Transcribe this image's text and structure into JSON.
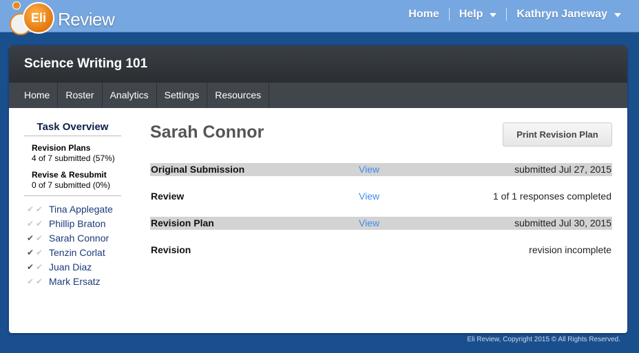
{
  "brand": {
    "logo_bubble": "Eli",
    "logo_word": "Review",
    "accent": "#e88a1d"
  },
  "topnav": {
    "home": "Home",
    "help": "Help",
    "user": "Kathryn Janeway"
  },
  "course": {
    "title": "Science Writing 101"
  },
  "tabs": [
    "Home",
    "Roster",
    "Analytics",
    "Settings",
    "Resources"
  ],
  "sidebar": {
    "title": "Task Overview",
    "stats": [
      {
        "label": "Revision Plans",
        "value": "4 of 7 submitted (57%)"
      },
      {
        "label": "Revise & Resubmit",
        "value": "0 of 7 submitted (0%)"
      }
    ],
    "students": [
      {
        "name": "Tina Applegate",
        "checks": [
          false,
          false
        ]
      },
      {
        "name": "Phillip Braton",
        "checks": [
          false,
          false
        ]
      },
      {
        "name": "Sarah Connor",
        "checks": [
          true,
          false
        ]
      },
      {
        "name": "Tenzin Corlat",
        "checks": [
          true,
          false
        ]
      },
      {
        "name": "Juan Diaz",
        "checks": [
          true,
          false
        ]
      },
      {
        "name": "Mark Ersatz",
        "checks": [
          false,
          false
        ]
      }
    ]
  },
  "main": {
    "student_name": "Sarah Connor",
    "print_button": "Print Revision Plan",
    "rows": [
      {
        "label": "Original Submission",
        "view": "View",
        "status": "submitted Jul 27, 2015",
        "shaded": true
      },
      {
        "label": "Review",
        "view": "View",
        "status": "1 of 1 responses completed",
        "shaded": false
      },
      {
        "label": "Revision Plan",
        "view": "View",
        "status": "submitted Jul 30, 2015",
        "shaded": true
      },
      {
        "label": "Revision",
        "view": "",
        "status": "revision incomplete",
        "shaded": false
      }
    ]
  },
  "footer": {
    "text": "Eli Review, Copyright 2015 © All Rights Reserved."
  }
}
